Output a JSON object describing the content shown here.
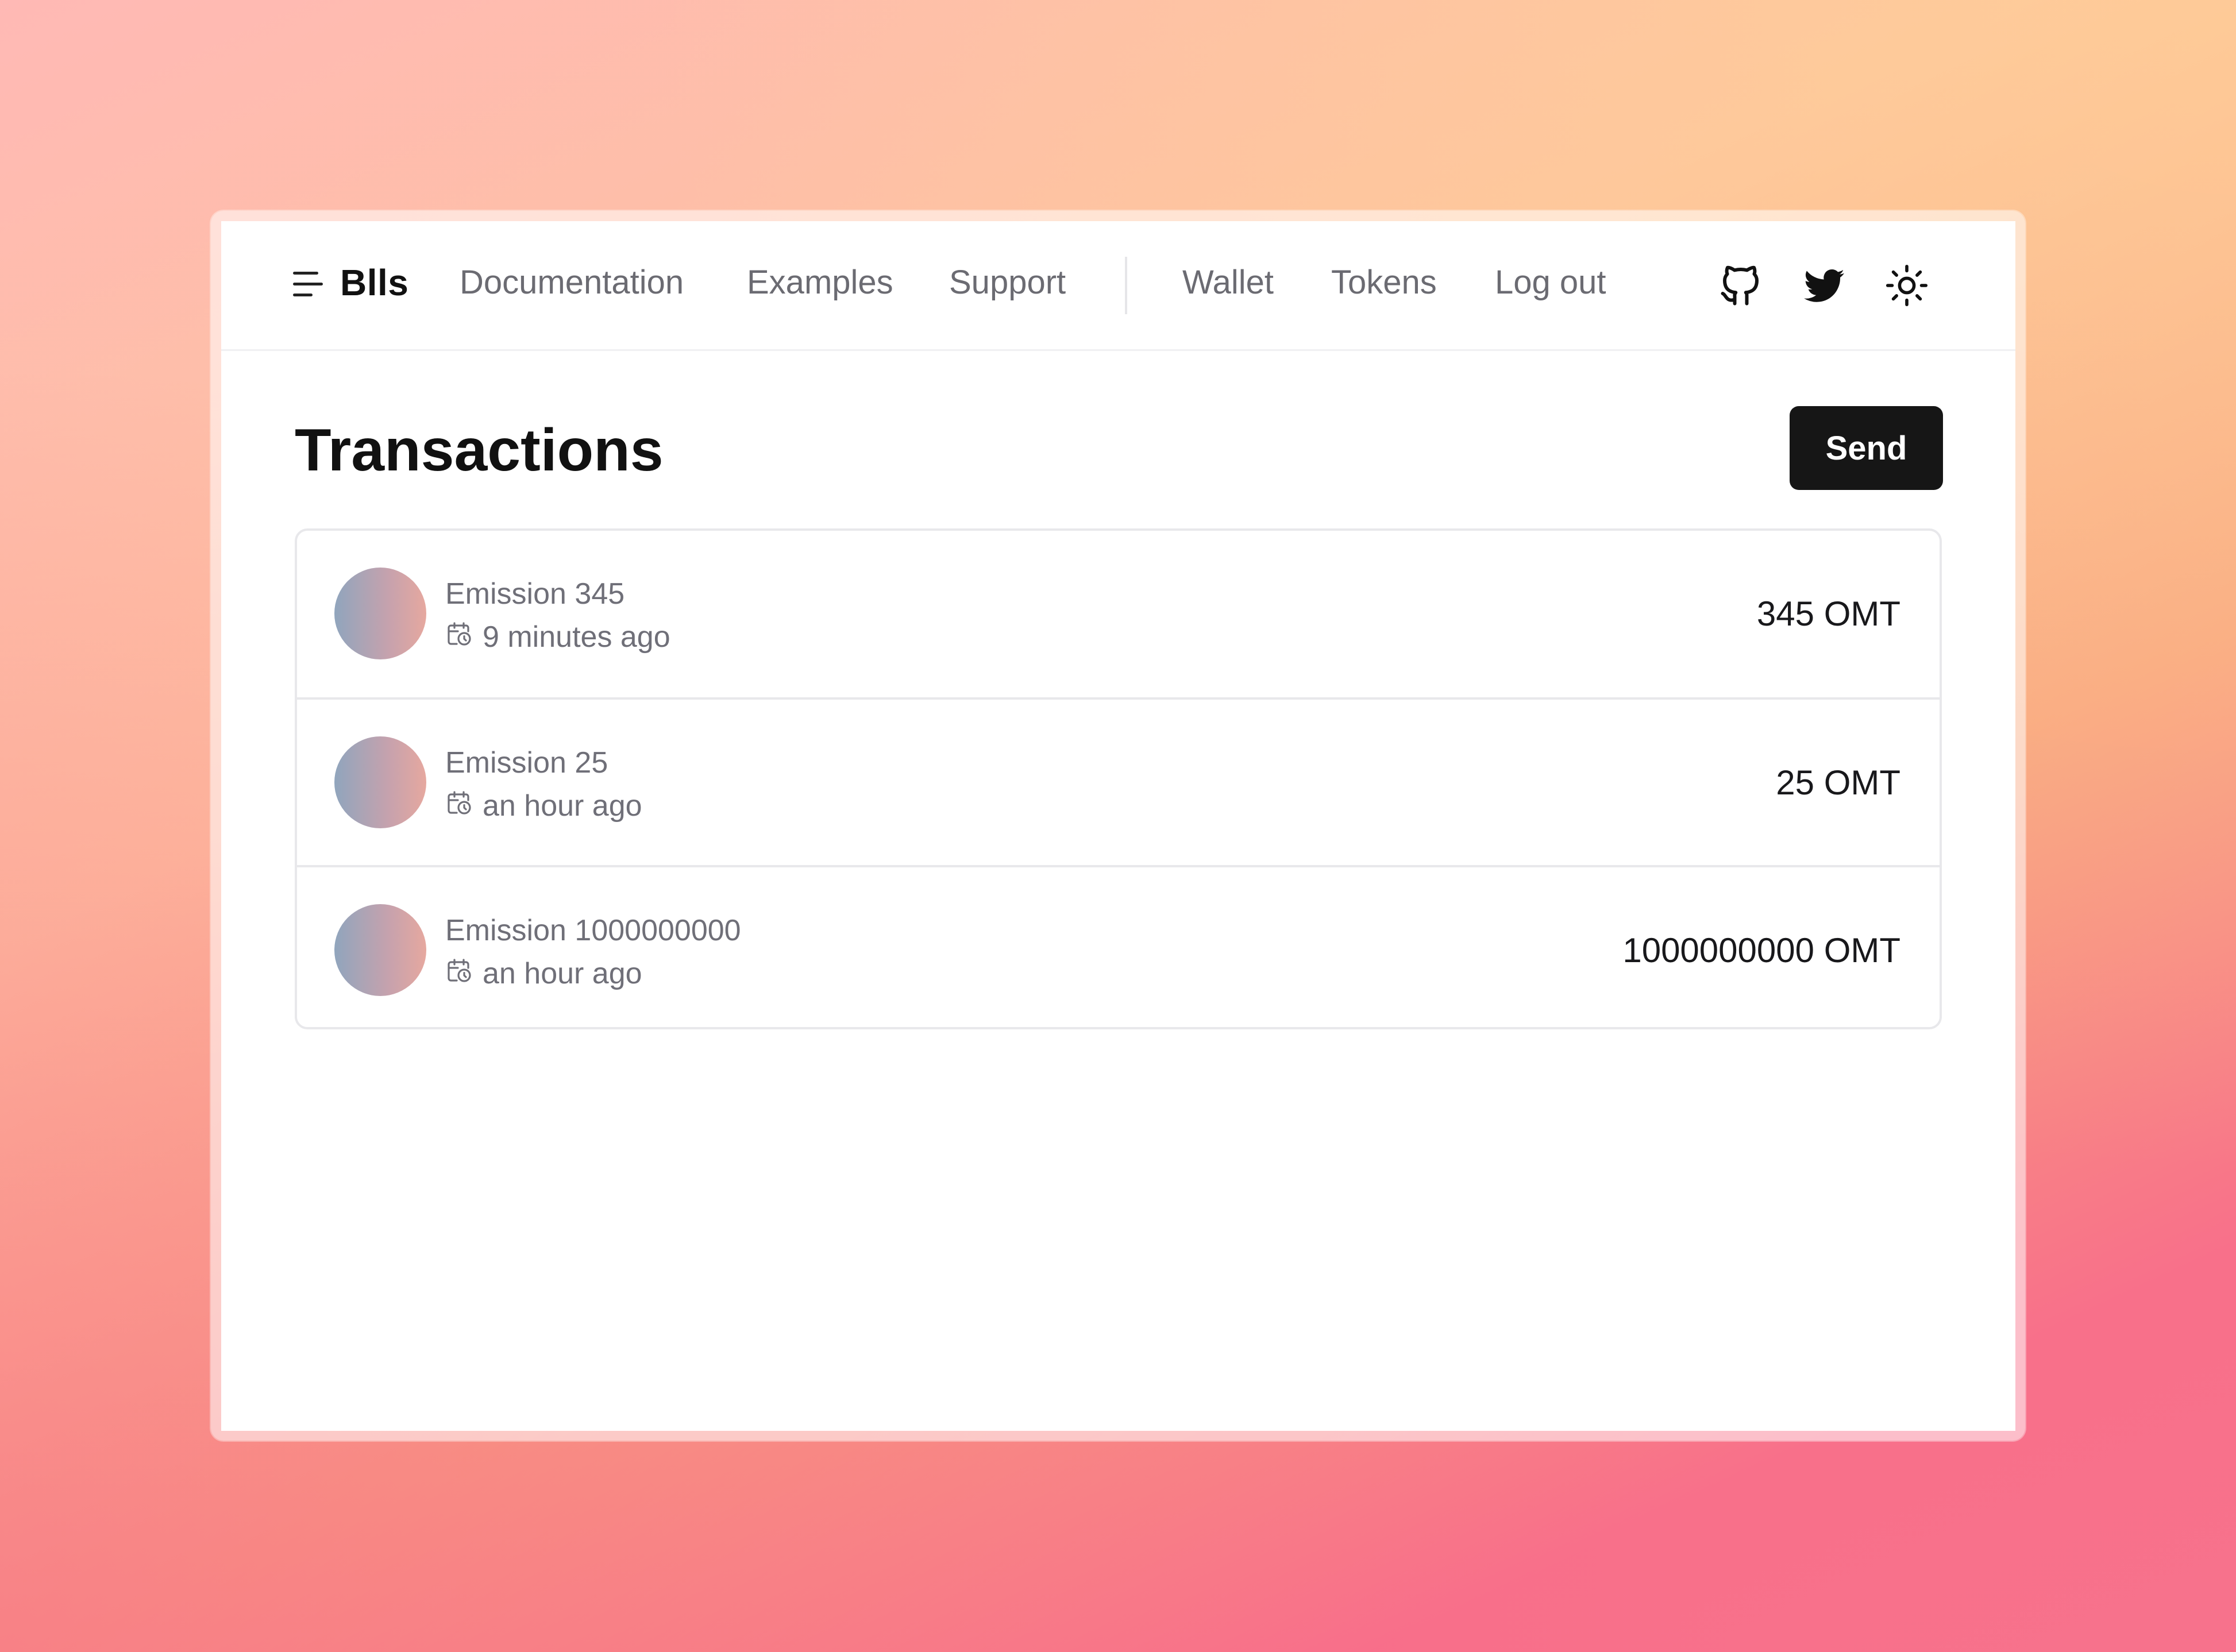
{
  "brand": {
    "name": "Blls"
  },
  "nav": {
    "primary": [
      "Documentation",
      "Examples",
      "Support"
    ],
    "secondary": [
      "Wallet",
      "Tokens",
      "Log out"
    ],
    "icons": [
      "github-icon",
      "twitter-icon",
      "sun-icon"
    ]
  },
  "page": {
    "title": "Transactions"
  },
  "actions": {
    "send_label": "Send"
  },
  "transactions": [
    {
      "title": "Emission 345",
      "time": "9 minutes ago",
      "amount": "345 OMT"
    },
    {
      "title": "Emission 25",
      "time": "an hour ago",
      "amount": "25 OMT"
    },
    {
      "title": "Emission 1000000000",
      "time": "an hour ago",
      "amount": "1000000000 OMT"
    }
  ],
  "colors": {
    "send_button": "#161616",
    "muted_text": "#6f6f78",
    "border": "#e8e8eb",
    "avatar_gradient": [
      "#90a5bd",
      "#e6a89f"
    ]
  }
}
